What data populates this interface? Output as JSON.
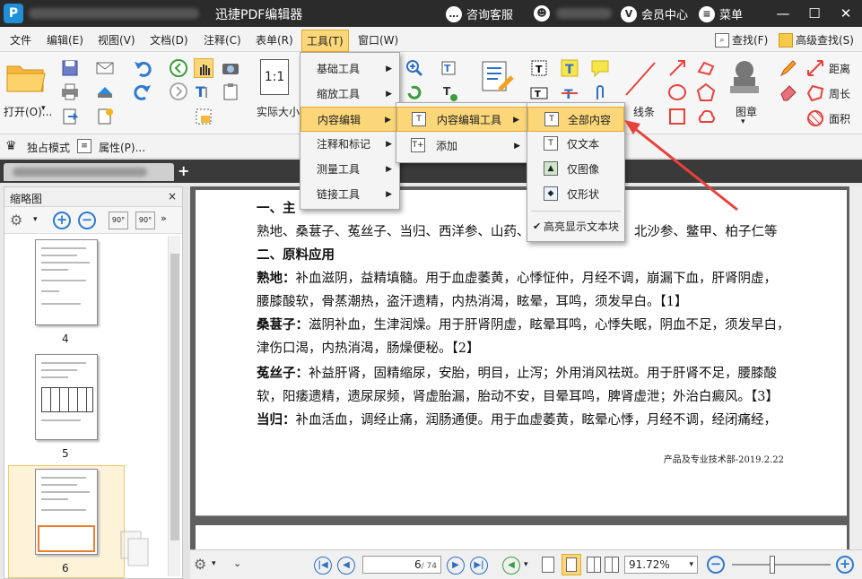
{
  "titlebar": {
    "app_name": "迅捷PDF编辑器",
    "support": "咨询客服",
    "vip": "会员中心",
    "menu": "菜单",
    "logo_letter": "P",
    "vip_letter": "V"
  },
  "menubar": {
    "items": [
      "文件",
      "编辑(E)",
      "视图(V)",
      "文档(D)",
      "注释(C)",
      "表单(R)",
      "工具(T)",
      "窗口(W)"
    ],
    "find": "查找(F)",
    "advanced_find": "高级查找(S)"
  },
  "ribbon": {
    "open": "打开(O)...",
    "actual_size": "实际大小",
    "actual_size_icon": "1:1",
    "line": "线条",
    "stamp": "图章",
    "distance": "距离",
    "perimeter": "周长",
    "area": "面积"
  },
  "modebar": {
    "exclusive_mode": "独占模式",
    "properties": "属性(P)..."
  },
  "thumbnails": {
    "title": "缩略图",
    "close": "×",
    "pages": [
      "4",
      "5",
      "6"
    ],
    "rotate_left": "90°",
    "rotate_right": "90°"
  },
  "tools_menu": {
    "items": [
      "基础工具",
      "缩放工具",
      "内容编辑",
      "注释和标记",
      "测量工具",
      "链接工具"
    ]
  },
  "content_edit_menu": {
    "items": [
      "内容编辑工具",
      "添加"
    ]
  },
  "content_tool_menu": {
    "items": [
      "全部内容",
      "仅文本",
      "仅图像",
      "仅形状"
    ],
    "highlight_blocks": "高亮显示文本块"
  },
  "document": {
    "heading1": "一、主",
    "ingredients": "熟地、桑葚子、菟丝子、当归、西洋参、山药、",
    "ingredients_tail": "、北沙参、鳖甲、柏子仁等",
    "heading2": "二、原料应用",
    "p1_term": "熟地：",
    "p1_a": "补血滋阴，益精填髓。用于血虚萎黄，心悸怔仲，月经不调，崩漏下血，肝肾阴虚，",
    "p1_b": "腰膝酸软，骨蒸潮热，盗汗遗精，内热消渴，眩晕，耳鸣，须发早白。【1】",
    "p2_term": "桑葚子：",
    "p2_a": "滋阴补血，生津润燥。用于肝肾阴虚，眩晕耳鸣，心悸失眠，阴血不足，须发早白，",
    "p2_b": "津伤口渴，内热消渴，肠燥便秘。【2】",
    "p3_term": "菟丝子：",
    "p3_a": "补益肝肾，固精缩尿，安胎，明目，止泻；外用消风祛斑。用于肝肾不足，腰膝酸",
    "p3_b": "软，阳痿遗精，遗尿尿频，肾虚胎漏，胎动不安，目晕耳鸣，脾肾虚泄；外治白癜风。【3】",
    "p4_term": "当归：",
    "p4_a": "补血活血，调经止痛，润肠通便。用于血虚萎黄，眩晕心悸，月经不调，经闭痛经，",
    "signature": "产品及专业技术部-2019.2.22"
  },
  "statusbar": {
    "page_current": "6",
    "page_total": "/ 74",
    "zoom": "91.72%"
  },
  "colors": {
    "accent": "#fbd77a",
    "arrow": "#e8413c",
    "nav": "#2e6fc7"
  }
}
